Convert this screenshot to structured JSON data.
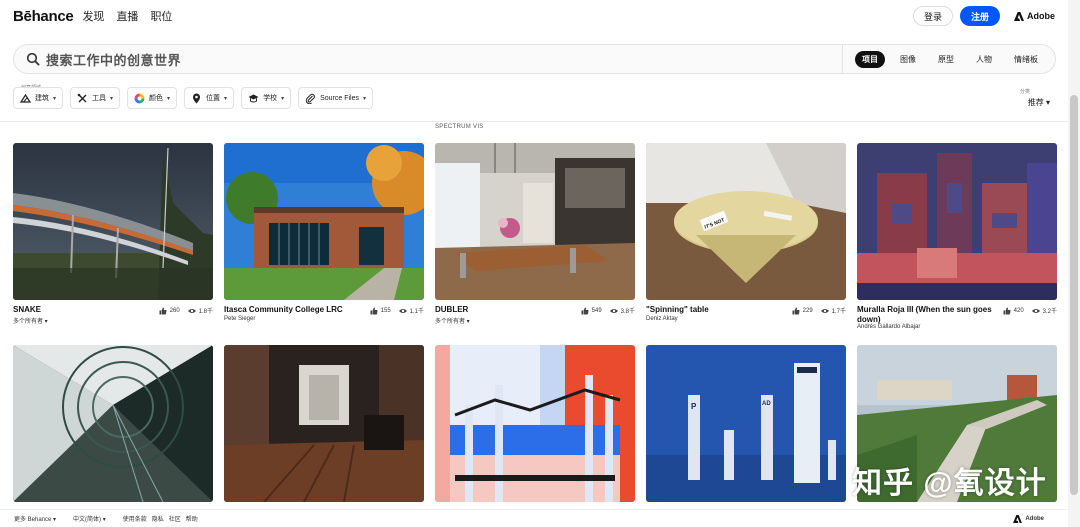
{
  "brand": {
    "logo": "Bēhance"
  },
  "nav": {
    "items": [
      "发现",
      "直播",
      "职位"
    ],
    "login": "登录",
    "signup": "注册",
    "adobe": "Adobe"
  },
  "search": {
    "placeholder": "搜索工作中的创意世界",
    "tabs": [
      {
        "label": "项目",
        "active": true
      },
      {
        "label": "图像",
        "active": false
      },
      {
        "label": "原型",
        "active": false
      },
      {
        "label": "人物",
        "active": false
      },
      {
        "label": "情绪板",
        "active": false
      }
    ]
  },
  "filters": {
    "caption": "创意领域",
    "chips": [
      {
        "label": "建筑",
        "icon": "architecture-icon"
      },
      {
        "label": "工具",
        "icon": "tools-icon"
      },
      {
        "label": "颜色",
        "icon": "color-wheel-icon"
      },
      {
        "label": "位置",
        "icon": "location-icon"
      },
      {
        "label": "学校",
        "icon": "school-icon"
      },
      {
        "label": "Source Files",
        "icon": "paperclip-icon"
      }
    ],
    "sort_caption": "分类",
    "sort_value": "推荐 ▾"
  },
  "section_label": "SPECTRUM VIS",
  "projects": [
    {
      "title": "SNAKE",
      "owner": "多个所有者 ▾",
      "likes": "260",
      "views": "1.8千"
    },
    {
      "title": "Itasca Community College LRC",
      "owner": "Pete Sieger",
      "likes": "155",
      "views": "1.1千"
    },
    {
      "title": "DUBLER",
      "owner": "多个所有者 ▾",
      "likes": "549",
      "views": "3.8千"
    },
    {
      "title": "\"Spinning\" table",
      "owner": "Deniz Aktay",
      "likes": "229",
      "views": "1.7千"
    },
    {
      "title": "Muralla Roja III (When the sun goes down)",
      "owner": "Andrés Gallardo Albajar",
      "likes": "420",
      "views": "3.2千"
    }
  ],
  "thumb_labels": {
    "table_sticker": "IT'S NOT",
    "sign_a": "P",
    "sign_b": "AD"
  },
  "footer": {
    "more": "更多 Behance ▾",
    "language": "中文(简体) ▾",
    "terms": "使用条款",
    "privacy": "隐私",
    "community": "社区",
    "help": "帮助",
    "adobe": "Adobe"
  },
  "watermark": "知乎 @氧设计",
  "colors": {
    "accent": "#0057ff",
    "text": "#191919"
  }
}
